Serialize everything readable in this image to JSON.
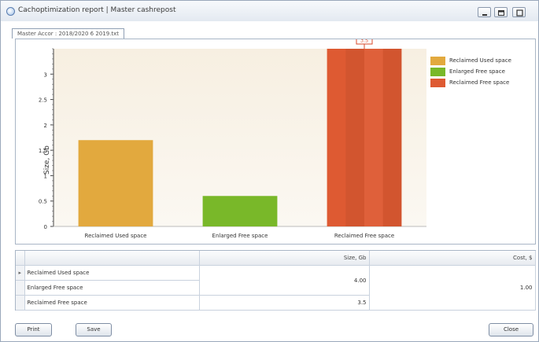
{
  "window": {
    "title": "Cachoptimization report | Master cashrepost",
    "tab_label": "Master Accor : 2018/2020 6 2019.txt"
  },
  "chart_data": {
    "type": "bar",
    "categories": [
      "Reclaimed Used space",
      "Enlarged Free space",
      "Reclaimed Free space"
    ],
    "values": [
      1.7,
      0.6,
      3.5
    ],
    "value_label": "3.5",
    "ylabel": "Size, Gb",
    "yticks": [
      "0",
      "0.5",
      "1",
      "1.5",
      "2",
      "2.5",
      "3"
    ],
    "ylim": [
      0,
      3.5
    ],
    "colors": [
      "#e2a93e",
      "#79b829",
      "#de5a32"
    ],
    "legend_position": "top-right",
    "legend": [
      {
        "label": "Reclaimed Used space",
        "color": "#e2a93e"
      },
      {
        "label": "Enlarged Free space",
        "color": "#79b829"
      },
      {
        "label": "Reclaimed Free space",
        "color": "#de5a32"
      }
    ]
  },
  "grid": {
    "headers": [
      "",
      "",
      "Size, Gb",
      "Cost, $"
    ],
    "rows": [
      {
        "marker": "▸",
        "name": "Reclaimed Used space"
      },
      {
        "marker": "",
        "name": "Enlarged Free space"
      },
      {
        "marker": "",
        "name": "Reclaimed Free space",
        "size": "3.5"
      }
    ],
    "merged_size": "4.00",
    "merged_cost": "1.00"
  },
  "buttons": {
    "print": "Print",
    "save": "Save",
    "close": "Close"
  }
}
